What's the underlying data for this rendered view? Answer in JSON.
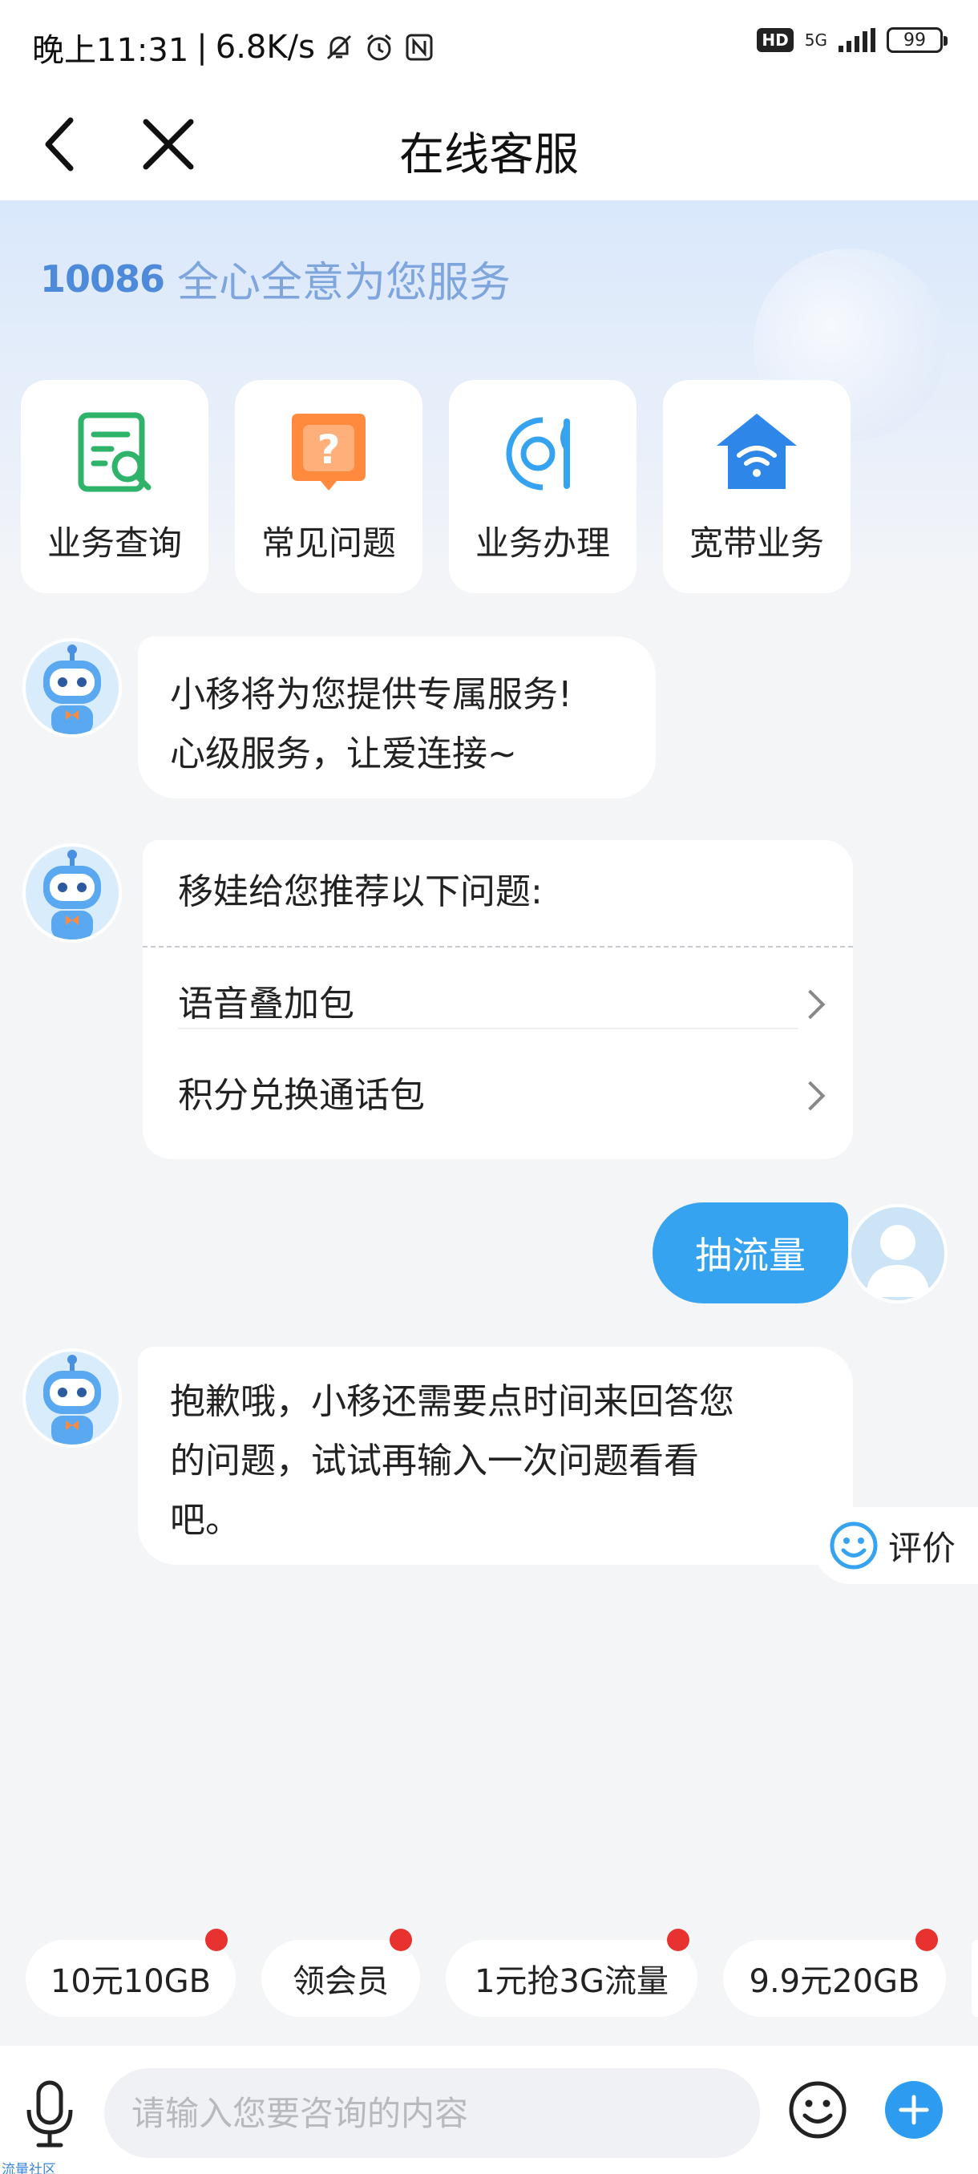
{
  "status_bar": {
    "time": "晚上11:31",
    "speed": "6.8K/s",
    "hd": "HD",
    "network": "5G",
    "battery": "99",
    "icons": [
      "mute-bell-icon",
      "alarm-icon",
      "nfc-icon",
      "signal-icon",
      "battery-icon"
    ]
  },
  "nav": {
    "title": "在线客服",
    "icons": [
      "back-icon",
      "close-icon"
    ]
  },
  "banner": {
    "logo_number": "10086",
    "slogan": "全心全意为您服务"
  },
  "quick_actions": [
    {
      "label": "业务查询",
      "icon": "document-search-icon",
      "color": "#2fb36b"
    },
    {
      "label": "常见问题",
      "icon": "question-bubble-icon",
      "color": "#ff8a3d"
    },
    {
      "label": "业务办理",
      "icon": "service-plate-icon",
      "color": "#35a3f0"
    },
    {
      "label": "宽带业务",
      "icon": "wifi-house-icon",
      "color": "#2d86e8"
    }
  ],
  "chat": {
    "greeting": [
      "小移将为您提供专属服务!",
      "心级服务，让爱连接~"
    ],
    "recommend_title": "移娃给您推荐以下问题:",
    "recommend_items": [
      "语音叠加包",
      "积分兑换通话包"
    ],
    "user_message": "抽流量",
    "bot_reply": [
      "抱歉哦，小移还需要点时间来回答您",
      "的问题，试试再输入一次问题看看",
      "吧。"
    ],
    "rate_label": "评价"
  },
  "chips": [
    "10元10GB",
    "领会员",
    "1元抢3G流量",
    "9.9元20GB"
  ],
  "input": {
    "placeholder": "请输入您要咨询的内容"
  },
  "watermark": "流量社区",
  "colors": {
    "accent": "#35a3f0",
    "badge": "#e8322f"
  }
}
